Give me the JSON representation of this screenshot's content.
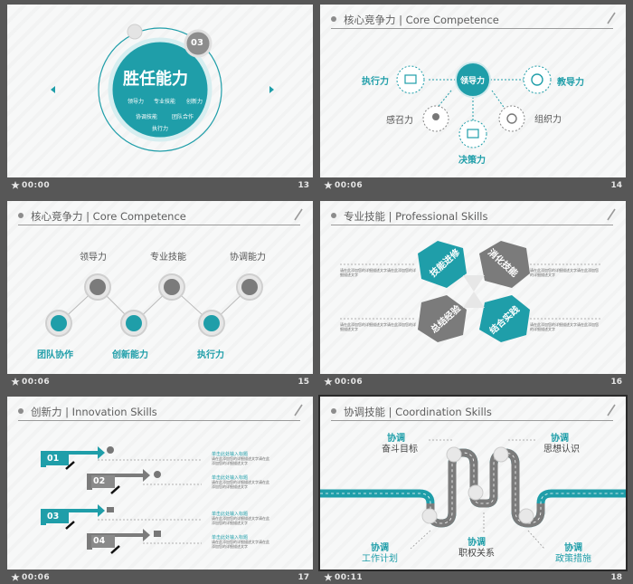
{
  "slides": [
    {
      "num": "13",
      "time": "00:00",
      "badge": "03",
      "title": "胜任能力",
      "items": [
        "领导力",
        "专业技能",
        "创新力",
        "协调技能",
        "团队合作",
        "执行力"
      ]
    },
    {
      "num": "14",
      "time": "00:06",
      "header": "核心竞争力 | Core Competence",
      "center": "领导力",
      "labels": [
        "执行力",
        "教导力",
        "感召力",
        "组织力",
        "决策力"
      ]
    },
    {
      "num": "15",
      "time": "00:06",
      "header": "核心竞争力 | Core Competence",
      "top_labels": [
        "领导力",
        "专业技能",
        "协调能力"
      ],
      "bottom_labels": [
        "团队协作",
        "创新能力",
        "执行力"
      ]
    },
    {
      "num": "16",
      "time": "00:06",
      "header": "专业技能 | Professional Skills",
      "blocks": [
        "技能进修",
        "消化技能",
        "总结经验",
        "结合实践"
      ],
      "desc": "请在此添加您的详细描述文字请在此添加您的详细描述文字"
    },
    {
      "num": "17",
      "time": "00:06",
      "header": "创新力 | Innovation Skills",
      "steps": [
        "01",
        "02",
        "03",
        "04"
      ],
      "step_title": "单击此处输入标题",
      "step_desc": "请在此添加您的详细描述文字请在此添加您的详细描述文字"
    },
    {
      "num": "18",
      "time": "00:11",
      "header": "协调技能 | Coordination Skills",
      "labels": [
        {
          "a": "协调",
          "b": "奋斗目标"
        },
        {
          "a": "协调",
          "b": "思想认识"
        },
        {
          "a": "协调",
          "b": "职权关系"
        },
        {
          "a": "协调",
          "b": "工作计划"
        },
        {
          "a": "协调",
          "b": "政策措施"
        }
      ]
    }
  ],
  "colors": {
    "teal": "#1f9ea9",
    "gray": "#7b7b7b",
    "bg": "#575757"
  }
}
